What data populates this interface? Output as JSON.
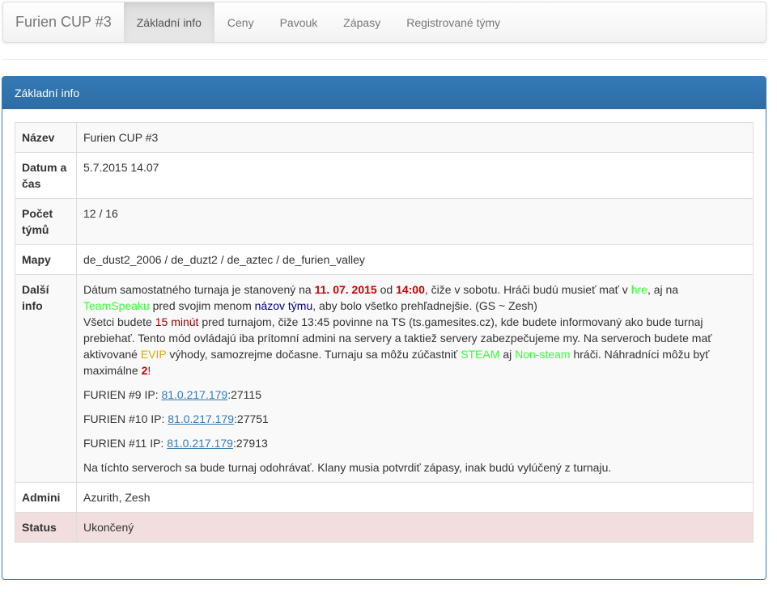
{
  "navbar": {
    "brand": "Furien CUP #3",
    "tabs": [
      {
        "label": "Základní info",
        "active": true
      },
      {
        "label": "Ceny"
      },
      {
        "label": "Pavouk"
      },
      {
        "label": "Zápasy"
      },
      {
        "label": "Registrované týmy"
      }
    ]
  },
  "panel": {
    "title": "Základní info",
    "rows": {
      "name": {
        "label": "Název",
        "value": "Furien CUP #3"
      },
      "datetime": {
        "label": "Datum a čas",
        "value": "5.7.2015 14.07"
      },
      "teams": {
        "label": "Počet týmů",
        "value": "12 / 16"
      },
      "maps": {
        "label": "Mapy",
        "value": "de_dust2_2006 / de_duzt2 / de_aztec / de_furien_valley"
      },
      "info": {
        "label": "Další info",
        "p1": {
          "t1": "Dátum samostatného turnaja je stanovený na ",
          "date": "11. 07. 2015",
          "t2": " od ",
          "time": "14:00",
          "t3": ", čiže v sobotu. Hráči budú musieť mať v ",
          "hre": "hre",
          "t4": ", aj na ",
          "ts": "TeamSpeaku",
          "t5": " pred svojim menom ",
          "nazov": "názov týmu",
          "t6": ", aby bolo všetko prehľadnejšie. (GS ~ Zesh)",
          "t7": "Všetci budete ",
          "minut": "15 minút",
          "t8": " pred turnajom, čiže 13:45 povinne na TS (ts.gamesites.cz), kde budete informovaný ako bude turnaj prebiehať. Tento mód ovládajú iba prítomní admini na servery a taktiež servery zabezpečujeme my. Na serveroch budete mať aktivované ",
          "evip": "EVIP",
          "t9": " výhody, samozrejme dočasne. Turnaju sa môžu zúčastniť ",
          "steam": "STEAM",
          "t10": " aj ",
          "nonsteam": "Non-steam",
          "t11": " hráči. Náhradníci môžu byť maximálne ",
          "two": "2",
          "t12": "!"
        },
        "servers": [
          {
            "prefix": "FURIEN #9 IP: ",
            "ip": "81.0.217.179",
            "port": ":27115"
          },
          {
            "prefix": "FURIEN #10 IP: ",
            "ip": "81.0.217.179",
            "port": ":27751"
          },
          {
            "prefix": "FURIEN #11 IP: ",
            "ip": "81.0.217.179",
            "port": ":27913"
          }
        ],
        "footer": "Na tíchto serveroch sa bude turnaj odohrávať. Klany musia potvrdiť zápasy, inak budú vylúčený z turnaju."
      },
      "admins": {
        "label": "Admini",
        "value": "Azurith, Zesh"
      },
      "status": {
        "label": "Status",
        "value": "Ukončený"
      }
    }
  }
}
